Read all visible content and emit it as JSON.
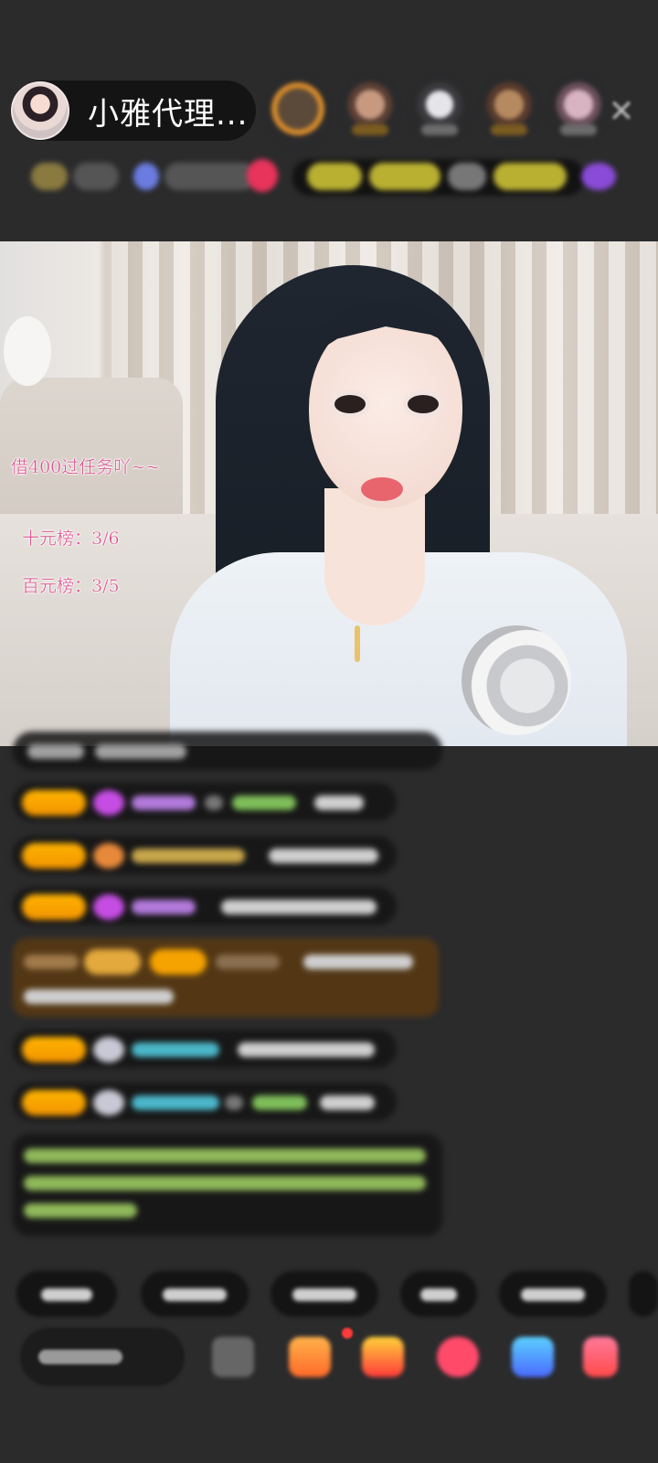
{
  "header": {
    "host_name": "小雅代理...",
    "close_icon": "✕"
  },
  "stream_overlay": {
    "line1": "借400过任务吖~~",
    "line2": "十元榜：3/6",
    "line3": "百元榜：3/5"
  },
  "colors": {
    "background": "#2b2b2c",
    "badge_orange": "#f29400",
    "overlay_pink": "#d9558f",
    "notify_red": "#ff3b3b"
  },
  "icons": [
    "close-icon",
    "gift-icon",
    "box-icon",
    "emoji-icon",
    "more-icon"
  ]
}
